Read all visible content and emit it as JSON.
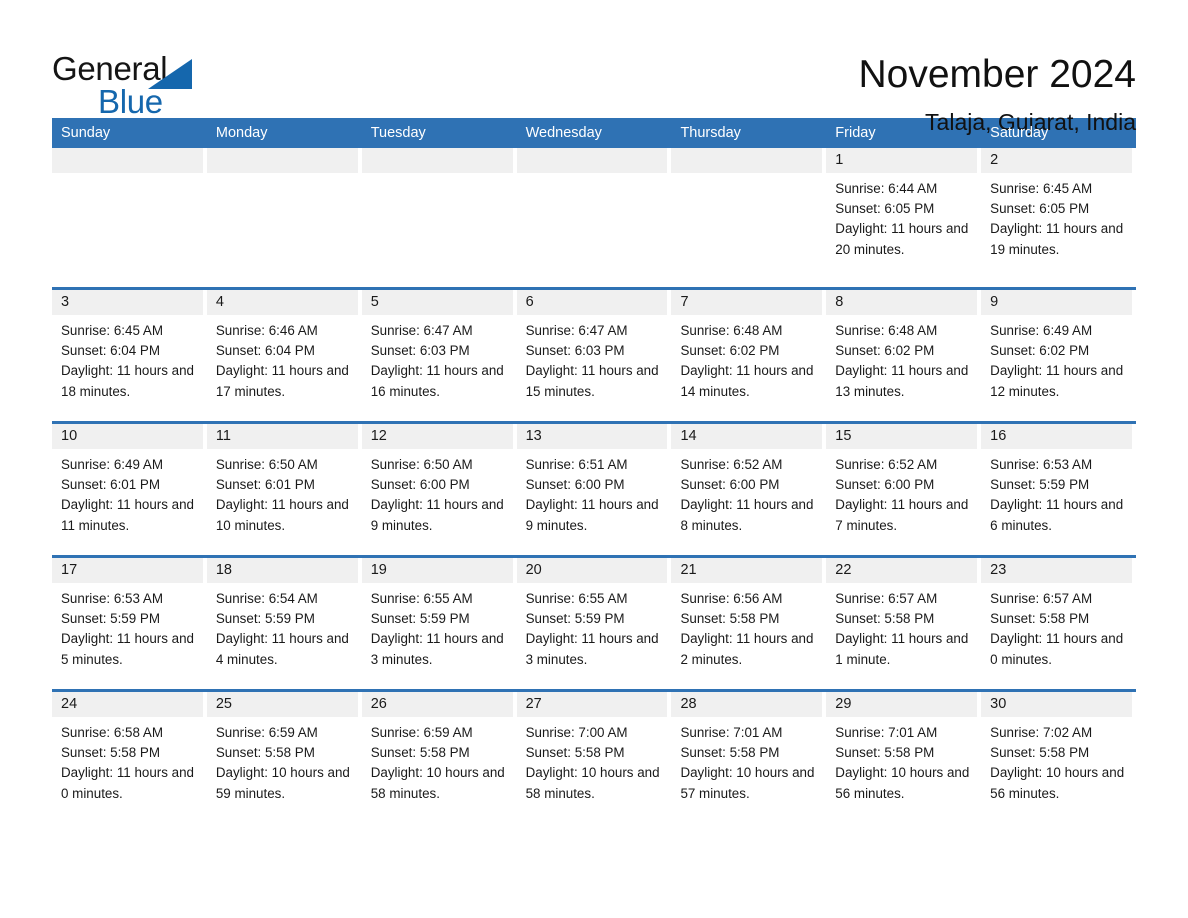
{
  "brand": {
    "name_dark": "General",
    "name_light": "Blue"
  },
  "header": {
    "month_title": "November 2024",
    "location": "Talaja, Gujarat, India"
  },
  "colors": {
    "header_blue": "#2f72b4",
    "brand_blue": "#1567ad",
    "day_strip_gray": "#f0f0f0"
  },
  "calendar": {
    "weekdays": [
      "Sunday",
      "Monday",
      "Tuesday",
      "Wednesday",
      "Thursday",
      "Friday",
      "Saturday"
    ],
    "labels": {
      "sunrise": "Sunrise:",
      "sunset": "Sunset:",
      "daylight": "Daylight:"
    },
    "weeks": [
      [
        {
          "day": "",
          "sunrise": "",
          "sunset": "",
          "daylight": ""
        },
        {
          "day": "",
          "sunrise": "",
          "sunset": "",
          "daylight": ""
        },
        {
          "day": "",
          "sunrise": "",
          "sunset": "",
          "daylight": ""
        },
        {
          "day": "",
          "sunrise": "",
          "sunset": "",
          "daylight": ""
        },
        {
          "day": "",
          "sunrise": "",
          "sunset": "",
          "daylight": ""
        },
        {
          "day": "1",
          "sunrise": "Sunrise: 6:44 AM",
          "sunset": "Sunset: 6:05 PM",
          "daylight": "Daylight: 11 hours and 20 minutes."
        },
        {
          "day": "2",
          "sunrise": "Sunrise: 6:45 AM",
          "sunset": "Sunset: 6:05 PM",
          "daylight": "Daylight: 11 hours and 19 minutes."
        }
      ],
      [
        {
          "day": "3",
          "sunrise": "Sunrise: 6:45 AM",
          "sunset": "Sunset: 6:04 PM",
          "daylight": "Daylight: 11 hours and 18 minutes."
        },
        {
          "day": "4",
          "sunrise": "Sunrise: 6:46 AM",
          "sunset": "Sunset: 6:04 PM",
          "daylight": "Daylight: 11 hours and 17 minutes."
        },
        {
          "day": "5",
          "sunrise": "Sunrise: 6:47 AM",
          "sunset": "Sunset: 6:03 PM",
          "daylight": "Daylight: 11 hours and 16 minutes."
        },
        {
          "day": "6",
          "sunrise": "Sunrise: 6:47 AM",
          "sunset": "Sunset: 6:03 PM",
          "daylight": "Daylight: 11 hours and 15 minutes."
        },
        {
          "day": "7",
          "sunrise": "Sunrise: 6:48 AM",
          "sunset": "Sunset: 6:02 PM",
          "daylight": "Daylight: 11 hours and 14 minutes."
        },
        {
          "day": "8",
          "sunrise": "Sunrise: 6:48 AM",
          "sunset": "Sunset: 6:02 PM",
          "daylight": "Daylight: 11 hours and 13 minutes."
        },
        {
          "day": "9",
          "sunrise": "Sunrise: 6:49 AM",
          "sunset": "Sunset: 6:02 PM",
          "daylight": "Daylight: 11 hours and 12 minutes."
        }
      ],
      [
        {
          "day": "10",
          "sunrise": "Sunrise: 6:49 AM",
          "sunset": "Sunset: 6:01 PM",
          "daylight": "Daylight: 11 hours and 11 minutes."
        },
        {
          "day": "11",
          "sunrise": "Sunrise: 6:50 AM",
          "sunset": "Sunset: 6:01 PM",
          "daylight": "Daylight: 11 hours and 10 minutes."
        },
        {
          "day": "12",
          "sunrise": "Sunrise: 6:50 AM",
          "sunset": "Sunset: 6:00 PM",
          "daylight": "Daylight: 11 hours and 9 minutes."
        },
        {
          "day": "13",
          "sunrise": "Sunrise: 6:51 AM",
          "sunset": "Sunset: 6:00 PM",
          "daylight": "Daylight: 11 hours and 9 minutes."
        },
        {
          "day": "14",
          "sunrise": "Sunrise: 6:52 AM",
          "sunset": "Sunset: 6:00 PM",
          "daylight": "Daylight: 11 hours and 8 minutes."
        },
        {
          "day": "15",
          "sunrise": "Sunrise: 6:52 AM",
          "sunset": "Sunset: 6:00 PM",
          "daylight": "Daylight: 11 hours and 7 minutes."
        },
        {
          "day": "16",
          "sunrise": "Sunrise: 6:53 AM",
          "sunset": "Sunset: 5:59 PM",
          "daylight": "Daylight: 11 hours and 6 minutes."
        }
      ],
      [
        {
          "day": "17",
          "sunrise": "Sunrise: 6:53 AM",
          "sunset": "Sunset: 5:59 PM",
          "daylight": "Daylight: 11 hours and 5 minutes."
        },
        {
          "day": "18",
          "sunrise": "Sunrise: 6:54 AM",
          "sunset": "Sunset: 5:59 PM",
          "daylight": "Daylight: 11 hours and 4 minutes."
        },
        {
          "day": "19",
          "sunrise": "Sunrise: 6:55 AM",
          "sunset": "Sunset: 5:59 PM",
          "daylight": "Daylight: 11 hours and 3 minutes."
        },
        {
          "day": "20",
          "sunrise": "Sunrise: 6:55 AM",
          "sunset": "Sunset: 5:59 PM",
          "daylight": "Daylight: 11 hours and 3 minutes."
        },
        {
          "day": "21",
          "sunrise": "Sunrise: 6:56 AM",
          "sunset": "Sunset: 5:58 PM",
          "daylight": "Daylight: 11 hours and 2 minutes."
        },
        {
          "day": "22",
          "sunrise": "Sunrise: 6:57 AM",
          "sunset": "Sunset: 5:58 PM",
          "daylight": "Daylight: 11 hours and 1 minute."
        },
        {
          "day": "23",
          "sunrise": "Sunrise: 6:57 AM",
          "sunset": "Sunset: 5:58 PM",
          "daylight": "Daylight: 11 hours and 0 minutes."
        }
      ],
      [
        {
          "day": "24",
          "sunrise": "Sunrise: 6:58 AM",
          "sunset": "Sunset: 5:58 PM",
          "daylight": "Daylight: 11 hours and 0 minutes."
        },
        {
          "day": "25",
          "sunrise": "Sunrise: 6:59 AM",
          "sunset": "Sunset: 5:58 PM",
          "daylight": "Daylight: 10 hours and 59 minutes."
        },
        {
          "day": "26",
          "sunrise": "Sunrise: 6:59 AM",
          "sunset": "Sunset: 5:58 PM",
          "daylight": "Daylight: 10 hours and 58 minutes."
        },
        {
          "day": "27",
          "sunrise": "Sunrise: 7:00 AM",
          "sunset": "Sunset: 5:58 PM",
          "daylight": "Daylight: 10 hours and 58 minutes."
        },
        {
          "day": "28",
          "sunrise": "Sunrise: 7:01 AM",
          "sunset": "Sunset: 5:58 PM",
          "daylight": "Daylight: 10 hours and 57 minutes."
        },
        {
          "day": "29",
          "sunrise": "Sunrise: 7:01 AM",
          "sunset": "Sunset: 5:58 PM",
          "daylight": "Daylight: 10 hours and 56 minutes."
        },
        {
          "day": "30",
          "sunrise": "Sunrise: 7:02 AM",
          "sunset": "Sunset: 5:58 PM",
          "daylight": "Daylight: 10 hours and 56 minutes."
        }
      ]
    ]
  }
}
